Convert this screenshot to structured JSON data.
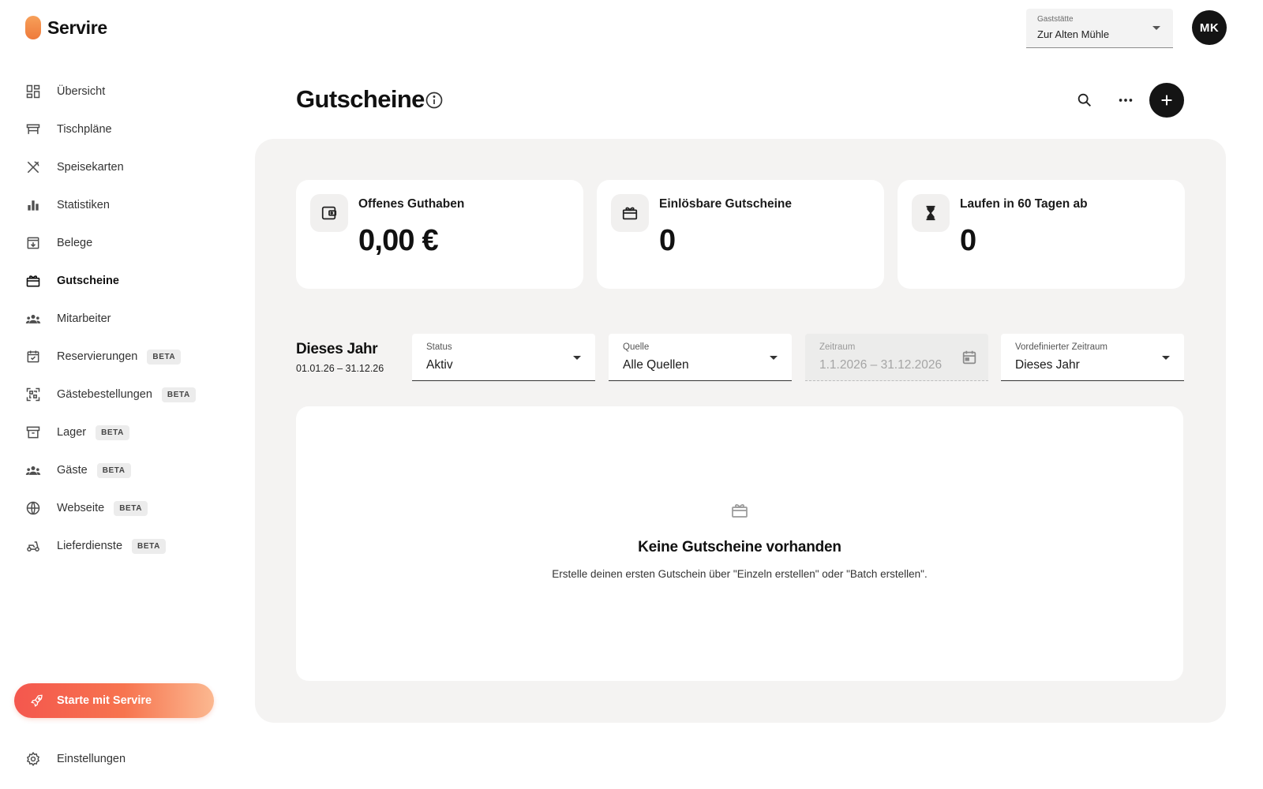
{
  "brand": {
    "name": "Servire",
    "accent": "#F08A45"
  },
  "topbar": {
    "restaurant_select": {
      "label": "Gaststätte",
      "value": "Zur Alten Mühle"
    },
    "avatar_initials": "MK"
  },
  "sidebar": {
    "items": [
      {
        "label": "Übersicht",
        "icon": "dashboard-icon",
        "beta": ""
      },
      {
        "label": "Tischpläne",
        "icon": "table-icon",
        "beta": ""
      },
      {
        "label": "Speisekarten",
        "icon": "cutlery-icon",
        "beta": ""
      },
      {
        "label": "Statistiken",
        "icon": "bar-chart-icon",
        "beta": ""
      },
      {
        "label": "Belege",
        "icon": "receipt-icon",
        "beta": ""
      },
      {
        "label": "Gutscheine",
        "icon": "gift-card-icon",
        "beta": "",
        "active": true
      },
      {
        "label": "Mitarbeiter",
        "icon": "group-icon",
        "beta": ""
      },
      {
        "label": "Reservierungen",
        "icon": "calendar-check-icon",
        "beta": "BETA"
      },
      {
        "label": "Gästebestellungen",
        "icon": "qr-code-icon",
        "beta": "BETA"
      },
      {
        "label": "Lager",
        "icon": "archive-icon",
        "beta": "BETA"
      },
      {
        "label": "Gäste",
        "icon": "guests-icon",
        "beta": "BETA"
      },
      {
        "label": "Webseite",
        "icon": "globe-icon",
        "beta": "BETA"
      },
      {
        "label": "Lieferdienste",
        "icon": "scooter-icon",
        "beta": "BETA"
      }
    ],
    "cta_label": "Starte mit Servire",
    "settings_label": "Einstellungen"
  },
  "page": {
    "title": "Gutscheine"
  },
  "kpis": [
    {
      "title": "Offenes Guthaben",
      "value": "0,00 €",
      "icon": "wallet-icon"
    },
    {
      "title": "Einlösbare Gutscheine",
      "value": "0",
      "icon": "gift-card-icon"
    },
    {
      "title": "Laufen in 60 Tagen ab",
      "value": "0",
      "icon": "hourglass-icon"
    }
  ],
  "filters": {
    "period_title": "Dieses Jahr",
    "period_range": "01.01.26 – 31.12.26",
    "status": {
      "label": "Status",
      "value": "Aktiv"
    },
    "source": {
      "label": "Quelle",
      "value": "Alle Quellen"
    },
    "range": {
      "label": "Zeitraum",
      "value": "1.1.2026 – 31.12.2026"
    },
    "preset": {
      "label": "Vordefinierter Zeitraum",
      "value": "Dieses Jahr"
    }
  },
  "empty_state": {
    "title": "Keine Gutscheine vorhanden",
    "text": "Erstelle deinen ersten Gutschein über \"Einzeln erstellen\" oder \"Batch erstellen\"."
  }
}
